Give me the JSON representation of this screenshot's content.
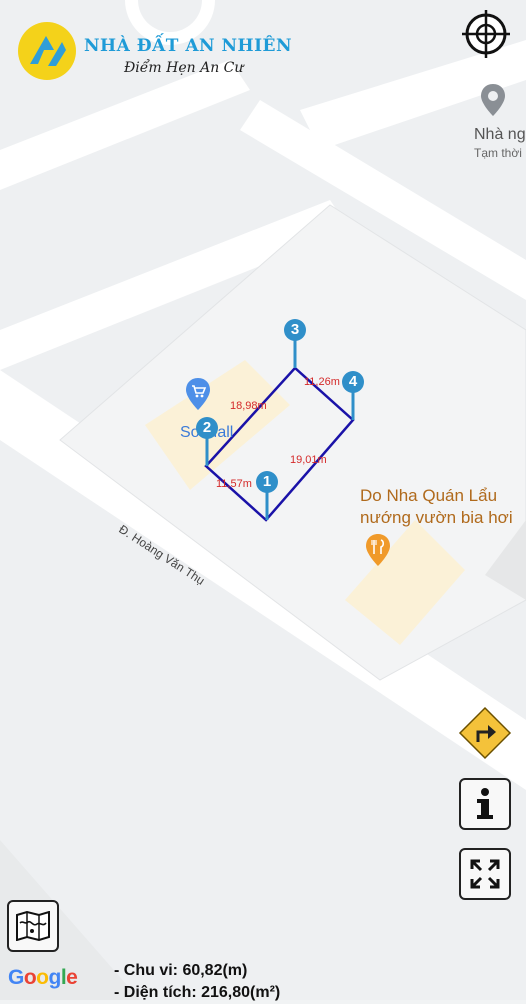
{
  "brand": {
    "name": "NHÀ ĐẤT AN NHIÊN",
    "slogan": "Điểm Hẹn An Cư",
    "accent": "#1f9bd7",
    "logo_bg": "#f4d21a"
  },
  "map": {
    "street_name": "Đ. Hoàng Văn Thụ",
    "poi_restaurant_line1": "Do Nha Quán Lẩu",
    "poi_restaurant_line2": "nướng vườn bia hơi",
    "poi_mall": "So Mall",
    "poi_top_right_line1": "Nhà ng",
    "poi_top_right_line2": "Tạm thời",
    "attribution": "Google"
  },
  "plot": {
    "color": "#1a12a8",
    "markers": [
      "1",
      "2",
      "3",
      "4"
    ],
    "edges": [
      "11,57m",
      "18,98m",
      "11,26m",
      "19,01m"
    ]
  },
  "stats": {
    "perimeter": "- Chu vi: 60,82(m)",
    "area": "- Diện tích: 216,80(m²)"
  },
  "controls": {
    "locate_icon": "crosshair-icon",
    "directions_icon": "turn-right-icon",
    "info_icon": "info-icon",
    "fullscreen_icon": "expand-icon",
    "layers_icon": "map-icon"
  }
}
